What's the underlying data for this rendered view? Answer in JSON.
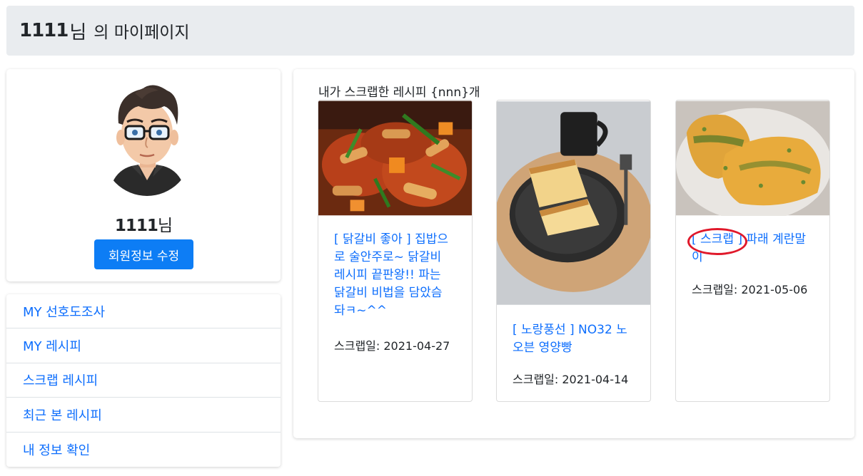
{
  "header": {
    "username": "1111",
    "nim": "님",
    "suffix": "의 마이페이지"
  },
  "profile": {
    "username": "1111",
    "nim": "님",
    "edit_button": "회원정보 수정"
  },
  "menu": {
    "items": [
      {
        "label": "MY 선호도조사"
      },
      {
        "label": "MY 레시피"
      },
      {
        "label": "스크랩 레시피"
      },
      {
        "label": "최근 본 레시피"
      },
      {
        "label": "내 정보 확인"
      }
    ]
  },
  "main": {
    "title": "내가 스크랩한 레시피 {nnn}개",
    "recipes": [
      {
        "title": "[ 닭갈비 좋아 ] 집밥으로 술안주로~ 닭갈비 레시피 끝판왕!! 파는 닭갈비 비법을 담았슴돠ㅋ~^^",
        "title_lines": [
          "[ 닭갈비 좋아 ] 집밥으",
          "로 술안주로~ 닭갈비",
          "레시피 끝판왕!! 파는",
          "닭갈비 비법을 담았슴",
          "돠ㅋ~^^"
        ],
        "date": "스크랩일: 2021-04-27"
      },
      {
        "title": "[ 노랑풍선 ] NO32 노오븐 영양빵",
        "title_lines": [
          "[ 노랑풍선 ] NO32 노",
          "오븐 영양빵"
        ],
        "date": "스크랩일: 2021-04-14"
      },
      {
        "title": "[ 스크랩 ] 파래 계란말이",
        "title_lines": [
          "[ 스크랩 ] 파래 계란말",
          "이"
        ],
        "date": "스크랩일: 2021-05-06"
      }
    ]
  },
  "colors": {
    "link": "#0d6efd",
    "button": "#0d7df5",
    "header_bg": "#e9ecef",
    "annotation": "#e0182a"
  }
}
